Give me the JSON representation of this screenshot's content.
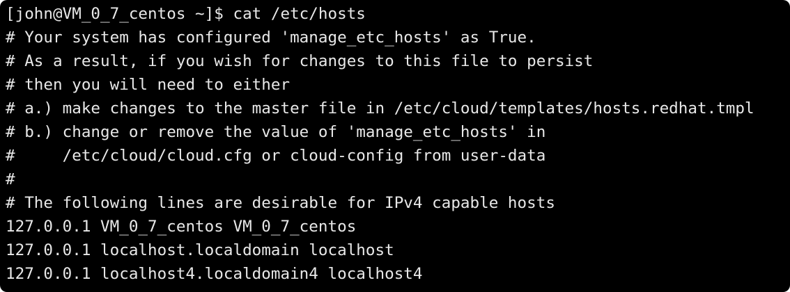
{
  "terminal": {
    "prompt_line": "[john@VM_0_7_centos ~]$ cat /etc/hosts",
    "lines": [
      "# Your system has configured 'manage_etc_hosts' as True.",
      "# As a result, if you wish for changes to this file to persist",
      "# then you will need to either",
      "# a.) make changes to the master file in /etc/cloud/templates/hosts.redhat.tmpl",
      "# b.) change or remove the value of 'manage_etc_hosts' in",
      "#     /etc/cloud/cloud.cfg or cloud-config from user-data",
      "#",
      "# The following lines are desirable for IPv4 capable hosts",
      "127.0.0.1 VM_0_7_centos VM_0_7_centos",
      "127.0.0.1 localhost.localdomain localhost",
      "127.0.0.1 localhost4.localdomain4 localhost4"
    ],
    "colors": {
      "background": "#000000",
      "text": "#e8e8e8"
    }
  }
}
